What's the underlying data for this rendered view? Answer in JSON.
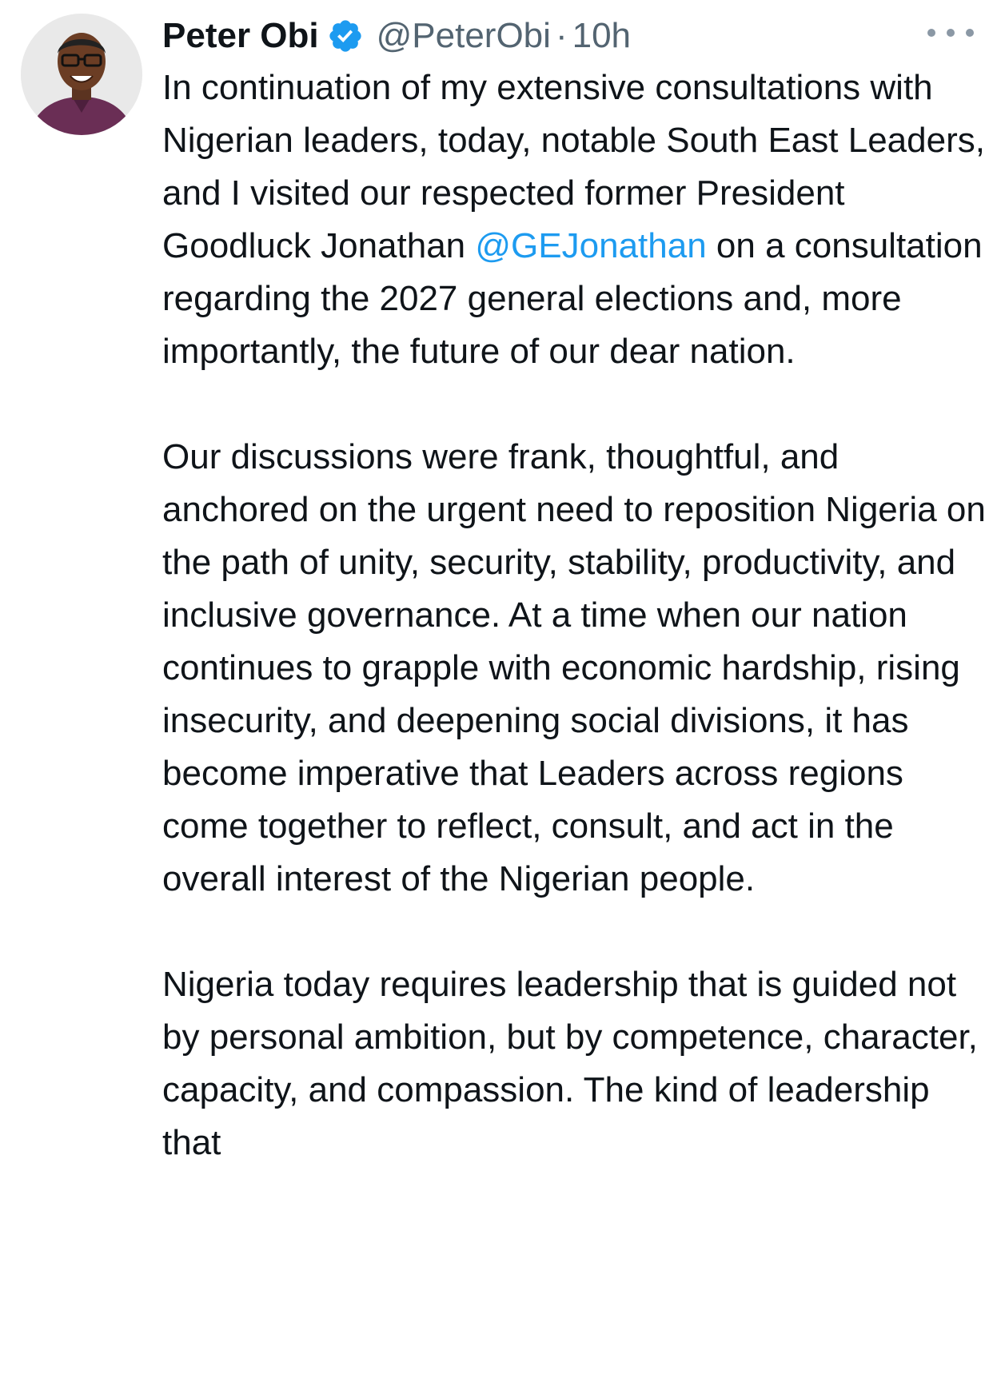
{
  "tweet": {
    "author_name": "Peter Obi",
    "handle": "@PeterObi",
    "separator": "·",
    "time": "10h",
    "verified": true,
    "accent_color": "#1d9bf0",
    "more_icon": "more-horizontal-icon",
    "body": {
      "p1_before_mention": "In continuation of my extensive consultations with Nigerian leaders, today, notable South East Leaders, and I visited our respected former President Goodluck Jonathan ",
      "mention": "@GEJonathan",
      "p1_after_mention": " on a consultation regarding the 2027 general elections and, more importantly, the future of our dear nation.",
      "p2": "Our discussions were frank, thoughtful, and anchored on the urgent need to reposition Nigeria on the path of unity, security, stability, productivity, and inclusive governance. At a time when our nation continues to grapple with economic hardship, rising insecurity, and deepening social divisions, it has become imperative that Leaders across regions come together to reflect, consult, and act in the overall interest of the Nigerian people.",
      "p3": "Nigeria today requires leadership that is guided not by personal ambition, but by competence, character, capacity, and compassion. The kind of leadership that"
    }
  }
}
